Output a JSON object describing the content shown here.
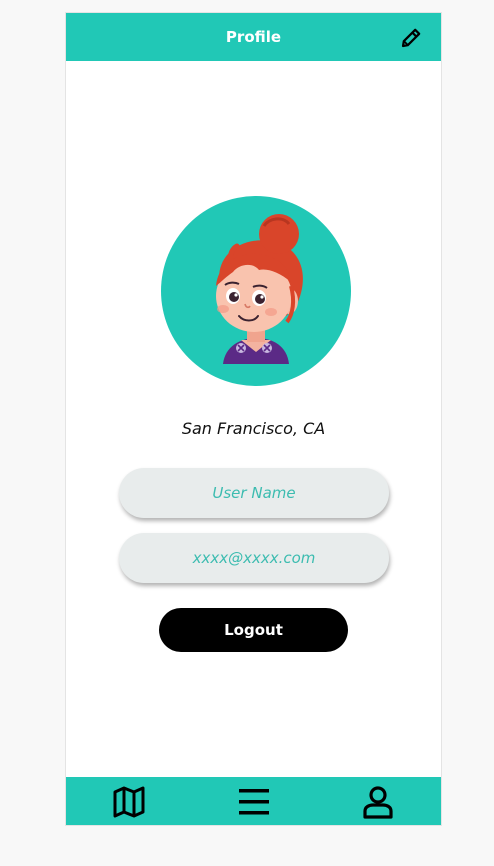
{
  "header": {
    "title": "Profile",
    "edit_icon": "pencil-icon"
  },
  "profile": {
    "avatar": "cartoon-girl-avatar",
    "location": "San Francisco, CA"
  },
  "form": {
    "username_placeholder": "User Name",
    "email_placeholder": "xxxx@xxxx.com"
  },
  "actions": {
    "logout_label": "Logout"
  },
  "bottom_nav": {
    "items": [
      {
        "icon": "map-icon"
      },
      {
        "icon": "menu-icon"
      },
      {
        "icon": "user-icon"
      }
    ]
  },
  "colors": {
    "accent": "#21c8b6",
    "button": "#000000",
    "field_bg": "#e8ecec"
  }
}
